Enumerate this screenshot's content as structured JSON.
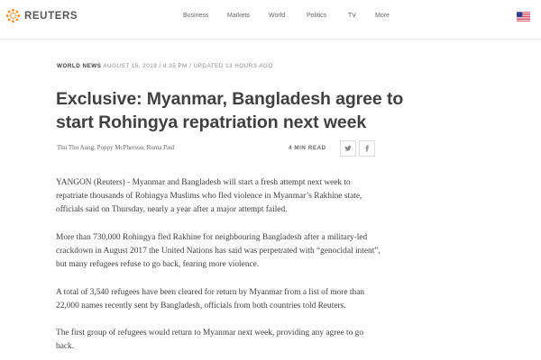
{
  "header": {
    "brand": "REUTERS",
    "nav": [
      {
        "label": "Business"
      },
      {
        "label": "Markets"
      },
      {
        "label": "World"
      },
      {
        "label": "Politics"
      },
      {
        "label": "TV"
      },
      {
        "label": "More"
      }
    ],
    "region_icon": "us-flag-icon"
  },
  "article": {
    "section": "WORLD NEWS",
    "meta": "AUGUST 15, 2019 / 8:35 PM / UPDATED 13 HOURS AGO",
    "headline": "Exclusive: Myanmar, Bangladesh agree to start Rohingya repatriation next week",
    "byline": "Thu Thu Aung, Poppy McPherson, Ruma Paul",
    "read_time": "4 MIN READ",
    "share_icons": [
      "twitter-icon",
      "facebook-icon"
    ],
    "paragraphs": [
      "YANGON (Reuters) - Myanmar and Bangladesh will start a fresh attempt next week to repatriate thousands of Rohingya Muslims who fled violence in Myanmar’s Rakhine state, officials said on Thursday, nearly a year after a major attempt failed.",
      "More than 730,000 Rohingya fled Rakhine for neighbouring Bangladesh after a military-led crackdown in August 2017 the United Nations has said was perpetrated with “genocidal intent”, but many refugees refuse to go back, fearing more violence.",
      "A total of 3,540 refugees have been cleared for return by Myanmar from a list of more than 22,000 names recently sent by Bangladesh, officials from both countries told Reuters.",
      "The first group of refugees would return to Myanmar next week, providing any agree to go back."
    ]
  },
  "colors": {
    "brand_orange": "#f28a1d",
    "text": "#404040",
    "muted": "#888888"
  }
}
